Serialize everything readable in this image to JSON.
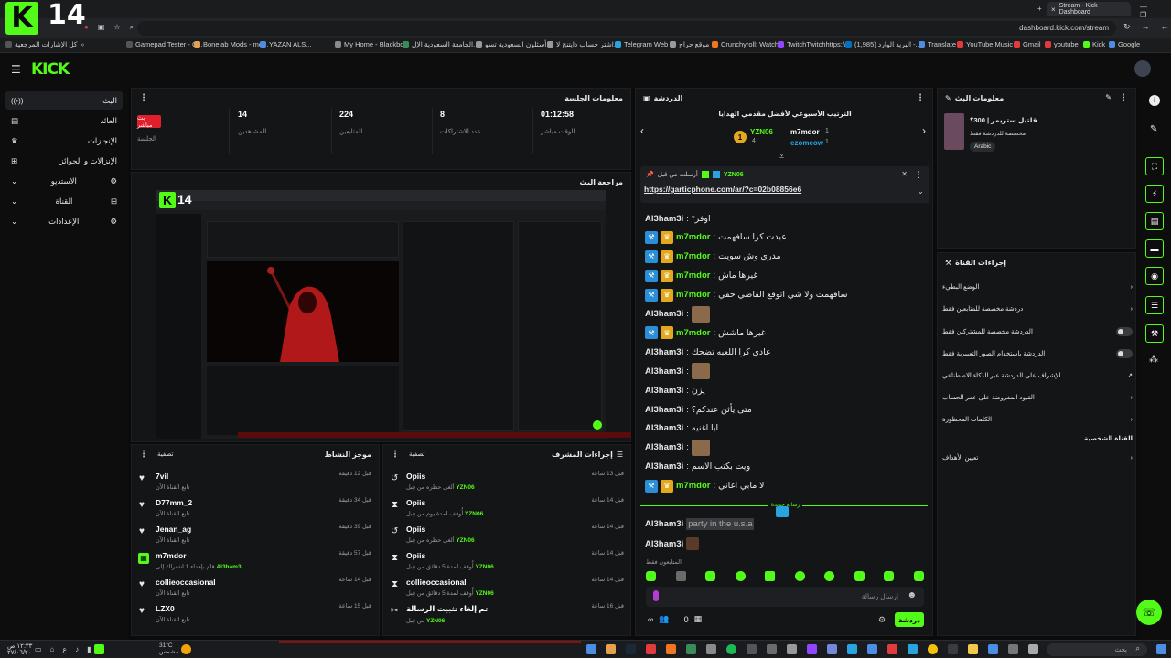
{
  "browser": {
    "tab_title": "Stream - Kick Dashboard",
    "url": "dashboard.kick.com/stream",
    "overlay_number": "14",
    "bookmarks": [
      "Gamepad Tester - C...",
      "Bonelab Mods - mo...",
      "YAZAN ALS...",
      "My Home - Blackbo...",
      "الجامعة السعودية الإل...",
      "أسئلون السعودية تسو...",
      "اشتر حساب دايتنج لا...",
      "Telegram Web",
      "موقع حراج",
      "Crunchyroll: Watch...",
      "TwitchTwitchhttps://...",
      "البريد الوارد (1,985) -...",
      "Translate",
      "YouTube Music",
      "Gmail",
      "youtube",
      "Kick",
      "Google",
      "كل الإشارات المرجعية"
    ]
  },
  "nav": {
    "items": [
      {
        "label": "البث",
        "icon": "broadcast-icon"
      },
      {
        "label": "العائد",
        "icon": "wallet-icon"
      },
      {
        "label": "الإنجازات",
        "icon": "trophy-icon"
      },
      {
        "label": "الإنزالات و الجوائز",
        "icon": "gift-icon"
      },
      {
        "label": "الاستديو",
        "icon": "studio-icon"
      },
      {
        "label": "القناة",
        "icon": "channel-icon"
      },
      {
        "label": "الإعدادات",
        "icon": "gear-icon"
      }
    ]
  },
  "session": {
    "title": "معلومات الجلسة",
    "live_badge": "بث مباشر",
    "session_label": "الجلسة",
    "stats": [
      {
        "value": "14",
        "label": "المشاهدين"
      },
      {
        "value": "224",
        "label": "المتابعين"
      },
      {
        "value": "8",
        "label": "عدد الاشتراكات"
      },
      {
        "value": "01:12:58",
        "label": "الوقت مباشر"
      }
    ]
  },
  "preview": {
    "title": "مراجعة البث",
    "inner_number": "14"
  },
  "activity": {
    "title": "موجز النشاط",
    "filter": "تصفية",
    "rows": [
      {
        "name": "7vil",
        "sub": "تابع القناة الآن",
        "time": "قبل 12 دقيقة",
        "icon": "heart-icon"
      },
      {
        "name": "D77mm_2",
        "sub": "تابع القناة الآن",
        "time": "قبل 34 دقيقة",
        "icon": "heart-icon"
      },
      {
        "name": "Jenan_ag",
        "sub": "تابع القناة الآن",
        "time": "قبل 39 دقيقة",
        "icon": "heart-icon"
      },
      {
        "name": "m7mdor",
        "sub": "قام بإهداء 1 اشتراك إلى",
        "sub_user": "Al3ham3i",
        "time": "قبل 57 دقيقة",
        "icon": "gift-icon"
      },
      {
        "name": "collieoccasional",
        "sub": "تابع القناة الآن",
        "time": "قبل 14 ساعة",
        "icon": "heart-icon"
      },
      {
        "name": "LZX0",
        "sub": "تابع القناة الآن",
        "time": "قبل 15 ساعة",
        "icon": "heart-icon"
      }
    ]
  },
  "modlog": {
    "title": "إجراءات المشرف",
    "filter": "تصفية",
    "rows": [
      {
        "name": "Opiis",
        "sub": "ألغى حظره من قِبل",
        "sub_user": "YZN06",
        "time": "قبل 13 ساعة",
        "icon": "undo-icon"
      },
      {
        "name": "Opiis",
        "sub": "أُوقف لمدة يوم من قِبل",
        "sub_user": "YZN06",
        "time": "قبل 14 ساعة",
        "icon": "hourglass-icon"
      },
      {
        "name": "Opiis",
        "sub": "ألغى حظره من قِبل",
        "sub_user": "YZN06",
        "time": "قبل 14 ساعة",
        "icon": "undo-icon"
      },
      {
        "name": "Opiis",
        "sub": "أُوقف لمدة 5 دقائق من قِبل",
        "sub_user": "YZN06",
        "time": "قبل 14 ساعة",
        "icon": "hourglass-icon"
      },
      {
        "name": "collieoccasional",
        "sub": "أُوقف لمدة 5 دقائق من قِبل",
        "sub_user": "YZN06",
        "time": "قبل 14 ساعة",
        "icon": "hourglass-icon"
      },
      {
        "name": "تم إلغاء تثبيت الرسالة",
        "sub": "من قِبل",
        "sub_user": "YZN06",
        "time": "قبل 16 ساعة",
        "icon": "unpin-icon"
      }
    ]
  },
  "chat": {
    "title": "الدردشة",
    "leaderboard_title": "الترتيب الأسبوعي لأفضل مقدمي الهدايا",
    "leaders": [
      {
        "name": "YZN06",
        "count": "4"
      },
      {
        "name": "m7mdor",
        "count": "1"
      },
      {
        "name": "ezomeow",
        "count": "1"
      }
    ],
    "pinned_header": "أرسلت من قبل",
    "pinned_user": "YZN06",
    "pinned_link": "https://garticphone.com/ar/?c=02b08856e6",
    "messages": [
      {
        "user": "Al3ham3i",
        "badges": [],
        "text": "*اوفر"
      },
      {
        "user": "m7mdor",
        "badges": [
          "mod",
          "vip"
        ],
        "text": "عبدت كرا سافهمت"
      },
      {
        "user": "m7mdor",
        "badges": [
          "mod",
          "vip"
        ],
        "text": "مدري وش سويت"
      },
      {
        "user": "m7mdor",
        "badges": [
          "mod",
          "vip"
        ],
        "text": "غيرها ماش"
      },
      {
        "user": "m7mdor",
        "badges": [
          "mod",
          "vip"
        ],
        "text": "سافهمت ولا شي اتوقع القاضي حقي"
      },
      {
        "user": "Al3ham3i",
        "badges": [],
        "text": "",
        "emote": true
      },
      {
        "user": "m7mdor",
        "badges": [
          "mod",
          "vip"
        ],
        "text": "غيرها ماشش"
      },
      {
        "user": "Al3ham3i",
        "badges": [],
        "text": "عادي كرا اللعبه تضحك"
      },
      {
        "user": "Al3ham3i",
        "badges": [],
        "text": "",
        "emote": true
      },
      {
        "user": "Al3ham3i",
        "badges": [],
        "text": "يزن"
      },
      {
        "user": "Al3ham3i",
        "badges": [],
        "text": "متى يأثن عندكم؟"
      },
      {
        "user": "Al3ham3i",
        "badges": [],
        "text": "ابا اغنيه"
      },
      {
        "user": "Al3ham3i",
        "badges": [],
        "text": "",
        "emote": true
      },
      {
        "user": "Al3ham3i",
        "badges": [],
        "text": "ويت بكتب الاسم"
      },
      {
        "user": "m7mdor",
        "badges": [
          "mod",
          "vip"
        ],
        "text": "لا مابي اغاني"
      }
    ],
    "after_divider": [
      {
        "user": "Al3ham3i",
        "text": "party in the u.s.a"
      },
      {
        "user": "Al3ham3i",
        "text": "",
        "emote": true
      }
    ],
    "divider_label": "رسالة جديدة",
    "followers_only": "المتابعون فقط",
    "input_placeholder": "إرسال رسالة",
    "send_label": "دردشة",
    "viewer_count": "0"
  },
  "streaminfo": {
    "title": "معلومات البث",
    "stream_title": "قلتبل ستريمر | 300؟",
    "category": "مخصصة للدردشة فقط",
    "tag": "Arabic"
  },
  "channel_actions": {
    "title": "إجراءات القناة",
    "rows": [
      {
        "label": "الوضع البطيء",
        "kind": "chevron"
      },
      {
        "label": "دردشة مخصصة للمتابعين فقط",
        "kind": "chevron"
      },
      {
        "label": "الدردشة مخصصة للمشتركين فقط",
        "kind": "toggle"
      },
      {
        "label": "الدردشة باستخدام الصور التعبيرية فقط",
        "kind": "toggle"
      },
      {
        "label": "الإشراف على الدردشة عبر الذكاء الاصطناعي",
        "kind": "external"
      },
      {
        "label": "القيود المفروضة على عمر الحساب",
        "kind": "chevron"
      },
      {
        "label": "الكلمات المحظورة",
        "kind": "chevron"
      }
    ],
    "section_label": "القناة الشخصية",
    "goals_label": "تعيين الأهداف"
  },
  "taskbar": {
    "search_placeholder": "بحث",
    "weather": "31°C",
    "weather_sub": "مشمس",
    "time": "١٢:٣٣ ص",
    "date": "٢٧/٠٦/٢٠"
  },
  "colors": {
    "accent": "#53fc18",
    "panel": "#141517",
    "bg": "#0b0b0c"
  }
}
